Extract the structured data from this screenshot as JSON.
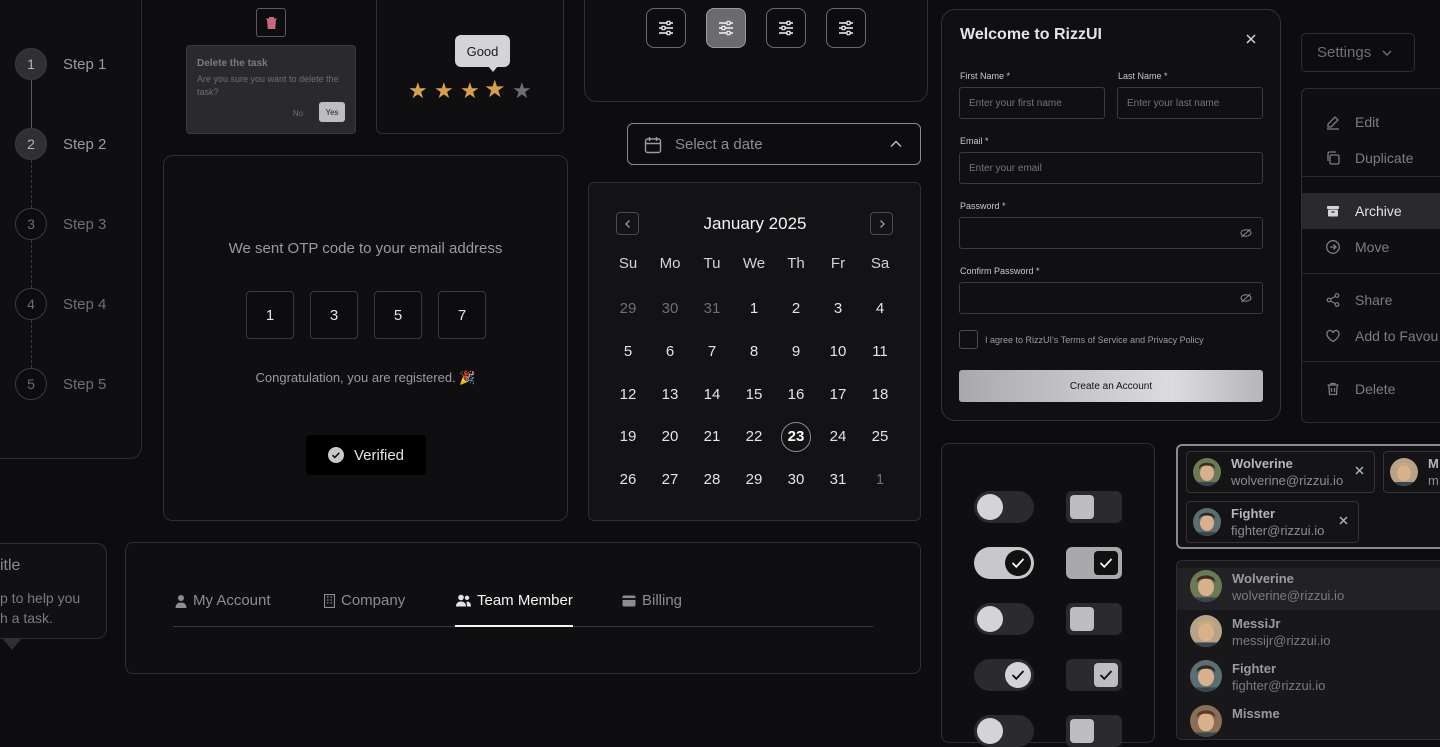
{
  "stepper": {
    "steps": [
      {
        "num": "1",
        "label": "Step 1"
      },
      {
        "num": "2",
        "label": "Step 2"
      },
      {
        "num": "3",
        "label": "Step 3"
      },
      {
        "num": "4",
        "label": "Step 4"
      },
      {
        "num": "5",
        "label": "Step 5"
      }
    ]
  },
  "tooltip_card": {
    "title_partial": "itle",
    "body_line1": "p to help you",
    "body_line2": "h a task."
  },
  "delete_popconfirm": {
    "title": "Delete the task",
    "message": "Are you sure you want to delete the task?",
    "no_label": "No",
    "yes_label": "Yes"
  },
  "rating": {
    "tooltip": "Good",
    "value": 4,
    "max": 5,
    "filled_color": "#d9a04a",
    "empty_color": "#6e6e74"
  },
  "filter_buttons": {
    "count": 4,
    "active_index": 1
  },
  "date_picker": {
    "placeholder": "Select a date"
  },
  "calendar": {
    "month_label": "January 2025",
    "weekdays": [
      "Su",
      "Mo",
      "Tu",
      "We",
      "Th",
      "Fr",
      "Sa"
    ],
    "weeks": [
      [
        "29",
        "30",
        "31",
        "1",
        "2",
        "3",
        "4"
      ],
      [
        "5",
        "6",
        "7",
        "8",
        "9",
        "10",
        "11"
      ],
      [
        "12",
        "13",
        "14",
        "15",
        "16",
        "17",
        "18"
      ],
      [
        "19",
        "20",
        "21",
        "22",
        "23",
        "24",
        "25"
      ],
      [
        "26",
        "27",
        "28",
        "29",
        "30",
        "31",
        "1"
      ]
    ],
    "selected_day": "23"
  },
  "otp": {
    "message": "We sent OTP code to your email address",
    "digits": [
      "1",
      "3",
      "5",
      "7"
    ],
    "success_message": "Congratulation, you are registered. 🎉",
    "verified_label": "Verified"
  },
  "signup_form": {
    "title": "Welcome to RizzUI",
    "first_name_label": "First Name *",
    "first_name_placeholder": "Enter your first name",
    "last_name_label": "Last Name *",
    "last_name_placeholder": "Enter your last name",
    "email_label": "Email *",
    "email_placeholder": "Enter your email",
    "password_label": "Password *",
    "confirm_password_label": "Confirm Password *",
    "terms_label": "I agree to RizzUI's Terms of Service and Privacy Policy",
    "submit_label": "Create an Account"
  },
  "settings_menu": {
    "trigger_label": "Settings",
    "items": [
      {
        "label": "Edit",
        "icon": "edit-icon"
      },
      {
        "label": "Duplicate",
        "icon": "duplicate-icon"
      },
      {
        "label": "Archive",
        "icon": "archive-icon"
      },
      {
        "label": "Move",
        "icon": "move-icon"
      },
      {
        "label": "Share",
        "icon": "share-icon"
      },
      {
        "label": "Add to Favou",
        "icon": "heart-icon"
      },
      {
        "label": "Delete",
        "icon": "trash-icon"
      }
    ],
    "active_item": "Archive"
  },
  "toggles": {
    "states": [
      false,
      true,
      false,
      true,
      false
    ]
  },
  "multi_select": {
    "chips": [
      {
        "name": "Wolverine",
        "email": "wolverine@rizzui.io"
      },
      {
        "name": "M",
        "email": "m"
      },
      {
        "name": "Fighter",
        "email": "fighter@rizzui.io"
      }
    ],
    "options": [
      {
        "name": "Wolverine",
        "email": "wolverine@rizzui.io"
      },
      {
        "name": "MessiJr",
        "email": "messijr@rizzui.io"
      },
      {
        "name": "Fighter",
        "email": "fighter@rizzui.io"
      },
      {
        "name": "Missme",
        "email": ""
      }
    ]
  },
  "tabs": {
    "items": [
      {
        "label": "My Account",
        "icon": "user-icon"
      },
      {
        "label": "Company",
        "icon": "building-icon"
      },
      {
        "label": "Team Member",
        "icon": "users-icon"
      },
      {
        "label": "Billing",
        "icon": "credit-card-icon"
      }
    ],
    "active_index": 2
  }
}
